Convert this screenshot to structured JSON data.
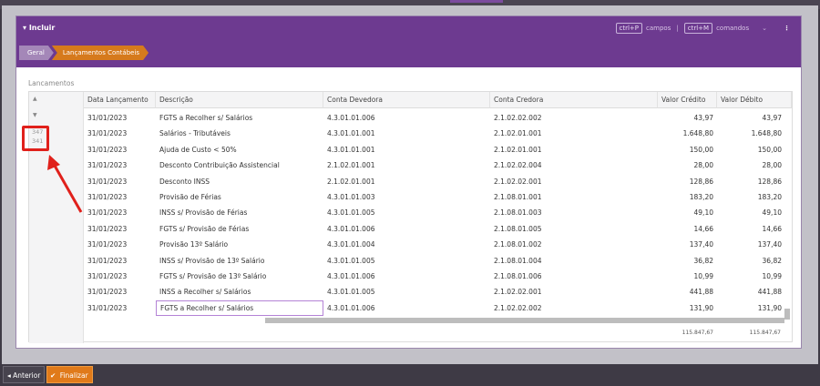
{
  "header": {
    "title": "Incluir",
    "title_icon": "caret-down-icon",
    "shortcut_fields_key": "ctrl+P",
    "shortcut_fields_label": "campos",
    "shortcut_sep": "|",
    "shortcut_commands_key": "ctrl+M",
    "shortcut_commands_label": "comandos",
    "chevron": "⌄",
    "menu": "⋮"
  },
  "breadcrumbs": [
    "Geral",
    "Lançamentos Contábeis"
  ],
  "section_label": "Lancamentos",
  "columns": [
    "Data Lançamento",
    "Descrição",
    "Conta Devedora",
    "Conta Credora",
    "Valor Crédito",
    "Valor Débito"
  ],
  "row_numbers": [
    "347",
    "341"
  ],
  "rows": [
    [
      "31/01/2023",
      "FGTS a Recolher s/ Salários",
      "4.3.01.01.006",
      "2.1.02.02.002",
      "43,97",
      "43,97"
    ],
    [
      "31/01/2023",
      "Salários - Tributáveis",
      "4.3.01.01.001",
      "2.1.02.01.001",
      "1.648,80",
      "1.648,80"
    ],
    [
      "31/01/2023",
      "Ajuda de Custo < 50%",
      "4.3.01.01.001",
      "2.1.02.01.001",
      "150,00",
      "150,00"
    ],
    [
      "31/01/2023",
      "Desconto Contribuição Assistencial",
      "2.1.02.01.001",
      "2.1.02.02.004",
      "28,00",
      "28,00"
    ],
    [
      "31/01/2023",
      "Desconto INSS",
      "2.1.02.01.001",
      "2.1.02.02.001",
      "128,86",
      "128,86"
    ],
    [
      "31/01/2023",
      "Provisão de Férias",
      "4.3.01.01.003",
      "2.1.08.01.001",
      "183,20",
      "183,20"
    ],
    [
      "31/01/2023",
      "INSS s/ Provisão de Férias",
      "4.3.01.01.005",
      "2.1.08.01.003",
      "49,10",
      "49,10"
    ],
    [
      "31/01/2023",
      "FGTS s/ Provisão de Férias",
      "4.3.01.01.006",
      "2.1.08.01.005",
      "14,66",
      "14,66"
    ],
    [
      "31/01/2023",
      "Provisão 13º Salário",
      "4.3.01.01.004",
      "2.1.08.01.002",
      "137,40",
      "137,40"
    ],
    [
      "31/01/2023",
      "INSS s/ Provisão de 13º Salário",
      "4.3.01.01.005",
      "2.1.08.01.004",
      "36,82",
      "36,82"
    ],
    [
      "31/01/2023",
      "FGTS s/ Provisão de 13º Salário",
      "4.3.01.01.006",
      "2.1.08.01.006",
      "10,99",
      "10,99"
    ],
    [
      "31/01/2023",
      "INSS a Recolher s/ Salários",
      "4.3.01.01.005",
      "2.1.02.02.001",
      "441,88",
      "441,88"
    ],
    [
      "31/01/2023",
      "FGTS a Recolher s/ Salários",
      "4.3.01.01.006",
      "2.1.02.02.002",
      "131,90",
      "131,90"
    ]
  ],
  "totals": {
    "credit": "115.847,67",
    "debit": "115.847,67"
  },
  "footer": {
    "prev_label": "Anterior",
    "prev_icon": "◂",
    "finish_label": "Finalizar",
    "finish_icon": "✔"
  },
  "colors": {
    "header": "#6d3a90",
    "breadcrumb_active": "#d67a1c",
    "finish_button": "#e07a1a",
    "highlight": "#e0201b"
  }
}
